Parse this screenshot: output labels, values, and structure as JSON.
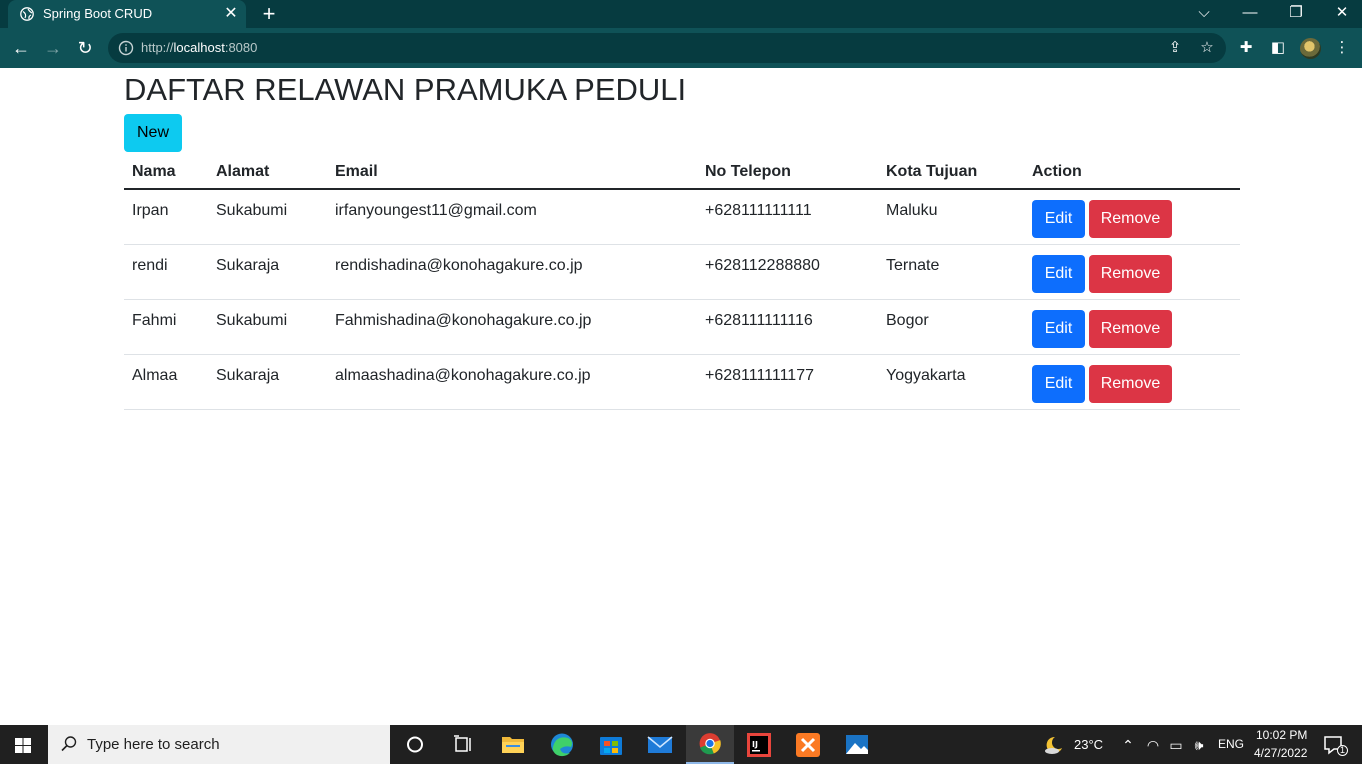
{
  "browser": {
    "tab_title": "Spring Boot CRUD",
    "tab_close": "✕",
    "new_tab": "+",
    "url_scheme_host": "http://",
    "url_host": "localhost",
    "url_port": ":8080",
    "window_controls": [
      "⌵",
      "—",
      "❐",
      "✕"
    ]
  },
  "page": {
    "heading": "DAFTAR RELAWAN PRAMUKA PEDULI",
    "new_button": "New",
    "table": {
      "headers": [
        "Nama",
        "Alamat",
        "Email",
        "No Telepon",
        "Kota Tujuan",
        "Action"
      ],
      "rows": [
        {
          "nama": "Irpan",
          "alamat": "Sukabumi",
          "email": "irfanyoungest11@gmail.com",
          "telepon": "+628111111111",
          "kota": "Maluku"
        },
        {
          "nama": "rendi",
          "alamat": "Sukaraja",
          "email": "rendishadina@konohagakure.co.jp",
          "telepon": "+628112288880",
          "kota": "Ternate"
        },
        {
          "nama": "Fahmi",
          "alamat": "Sukabumi",
          "email": "Fahmishadina@konohagakure.co.jp",
          "telepon": "+628111111116",
          "kota": "Bogor"
        },
        {
          "nama": "Almaa",
          "alamat": "Sukaraja",
          "email": "almaashadina@konohagakure.co.jp",
          "telepon": "+628111111177",
          "kota": "Yogyakarta"
        }
      ],
      "edit_label": "Edit",
      "remove_label": "Remove"
    }
  },
  "taskbar": {
    "search_placeholder": "Type here to search",
    "weather": "23°C",
    "language": "ENG",
    "time": "10:02 PM",
    "date": "4/27/2022",
    "notification_count": "1"
  },
  "colors": {
    "chrome_dark": "#063b40",
    "chrome_toolbar": "#0f5257",
    "btn_info": "#0dcaf0",
    "btn_primary": "#0d6efd",
    "btn_danger": "#dc3545"
  }
}
